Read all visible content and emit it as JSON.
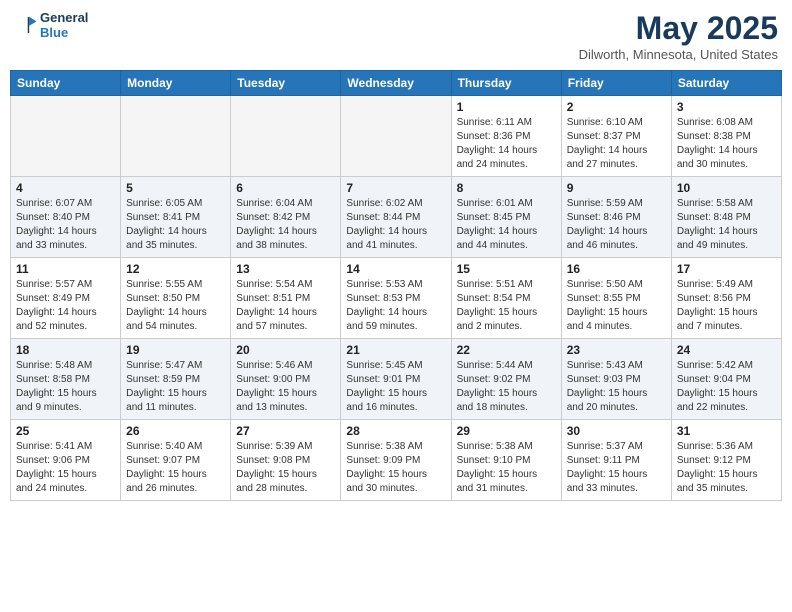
{
  "header": {
    "logo_line1": "General",
    "logo_line2": "Blue",
    "month": "May 2025",
    "location": "Dilworth, Minnesota, United States"
  },
  "days_of_week": [
    "Sunday",
    "Monday",
    "Tuesday",
    "Wednesday",
    "Thursday",
    "Friday",
    "Saturday"
  ],
  "weeks": [
    [
      {
        "day": "",
        "info": ""
      },
      {
        "day": "",
        "info": ""
      },
      {
        "day": "",
        "info": ""
      },
      {
        "day": "",
        "info": ""
      },
      {
        "day": "1",
        "info": "Sunrise: 6:11 AM\nSunset: 8:36 PM\nDaylight: 14 hours\nand 24 minutes."
      },
      {
        "day": "2",
        "info": "Sunrise: 6:10 AM\nSunset: 8:37 PM\nDaylight: 14 hours\nand 27 minutes."
      },
      {
        "day": "3",
        "info": "Sunrise: 6:08 AM\nSunset: 8:38 PM\nDaylight: 14 hours\nand 30 minutes."
      }
    ],
    [
      {
        "day": "4",
        "info": "Sunrise: 6:07 AM\nSunset: 8:40 PM\nDaylight: 14 hours\nand 33 minutes."
      },
      {
        "day": "5",
        "info": "Sunrise: 6:05 AM\nSunset: 8:41 PM\nDaylight: 14 hours\nand 35 minutes."
      },
      {
        "day": "6",
        "info": "Sunrise: 6:04 AM\nSunset: 8:42 PM\nDaylight: 14 hours\nand 38 minutes."
      },
      {
        "day": "7",
        "info": "Sunrise: 6:02 AM\nSunset: 8:44 PM\nDaylight: 14 hours\nand 41 minutes."
      },
      {
        "day": "8",
        "info": "Sunrise: 6:01 AM\nSunset: 8:45 PM\nDaylight: 14 hours\nand 44 minutes."
      },
      {
        "day": "9",
        "info": "Sunrise: 5:59 AM\nSunset: 8:46 PM\nDaylight: 14 hours\nand 46 minutes."
      },
      {
        "day": "10",
        "info": "Sunrise: 5:58 AM\nSunset: 8:48 PM\nDaylight: 14 hours\nand 49 minutes."
      }
    ],
    [
      {
        "day": "11",
        "info": "Sunrise: 5:57 AM\nSunset: 8:49 PM\nDaylight: 14 hours\nand 52 minutes."
      },
      {
        "day": "12",
        "info": "Sunrise: 5:55 AM\nSunset: 8:50 PM\nDaylight: 14 hours\nand 54 minutes."
      },
      {
        "day": "13",
        "info": "Sunrise: 5:54 AM\nSunset: 8:51 PM\nDaylight: 14 hours\nand 57 minutes."
      },
      {
        "day": "14",
        "info": "Sunrise: 5:53 AM\nSunset: 8:53 PM\nDaylight: 14 hours\nand 59 minutes."
      },
      {
        "day": "15",
        "info": "Sunrise: 5:51 AM\nSunset: 8:54 PM\nDaylight: 15 hours\nand 2 minutes."
      },
      {
        "day": "16",
        "info": "Sunrise: 5:50 AM\nSunset: 8:55 PM\nDaylight: 15 hours\nand 4 minutes."
      },
      {
        "day": "17",
        "info": "Sunrise: 5:49 AM\nSunset: 8:56 PM\nDaylight: 15 hours\nand 7 minutes."
      }
    ],
    [
      {
        "day": "18",
        "info": "Sunrise: 5:48 AM\nSunset: 8:58 PM\nDaylight: 15 hours\nand 9 minutes."
      },
      {
        "day": "19",
        "info": "Sunrise: 5:47 AM\nSunset: 8:59 PM\nDaylight: 15 hours\nand 11 minutes."
      },
      {
        "day": "20",
        "info": "Sunrise: 5:46 AM\nSunset: 9:00 PM\nDaylight: 15 hours\nand 13 minutes."
      },
      {
        "day": "21",
        "info": "Sunrise: 5:45 AM\nSunset: 9:01 PM\nDaylight: 15 hours\nand 16 minutes."
      },
      {
        "day": "22",
        "info": "Sunrise: 5:44 AM\nSunset: 9:02 PM\nDaylight: 15 hours\nand 18 minutes."
      },
      {
        "day": "23",
        "info": "Sunrise: 5:43 AM\nSunset: 9:03 PM\nDaylight: 15 hours\nand 20 minutes."
      },
      {
        "day": "24",
        "info": "Sunrise: 5:42 AM\nSunset: 9:04 PM\nDaylight: 15 hours\nand 22 minutes."
      }
    ],
    [
      {
        "day": "25",
        "info": "Sunrise: 5:41 AM\nSunset: 9:06 PM\nDaylight: 15 hours\nand 24 minutes."
      },
      {
        "day": "26",
        "info": "Sunrise: 5:40 AM\nSunset: 9:07 PM\nDaylight: 15 hours\nand 26 minutes."
      },
      {
        "day": "27",
        "info": "Sunrise: 5:39 AM\nSunset: 9:08 PM\nDaylight: 15 hours\nand 28 minutes."
      },
      {
        "day": "28",
        "info": "Sunrise: 5:38 AM\nSunset: 9:09 PM\nDaylight: 15 hours\nand 30 minutes."
      },
      {
        "day": "29",
        "info": "Sunrise: 5:38 AM\nSunset: 9:10 PM\nDaylight: 15 hours\nand 31 minutes."
      },
      {
        "day": "30",
        "info": "Sunrise: 5:37 AM\nSunset: 9:11 PM\nDaylight: 15 hours\nand 33 minutes."
      },
      {
        "day": "31",
        "info": "Sunrise: 5:36 AM\nSunset: 9:12 PM\nDaylight: 15 hours\nand 35 minutes."
      }
    ]
  ]
}
